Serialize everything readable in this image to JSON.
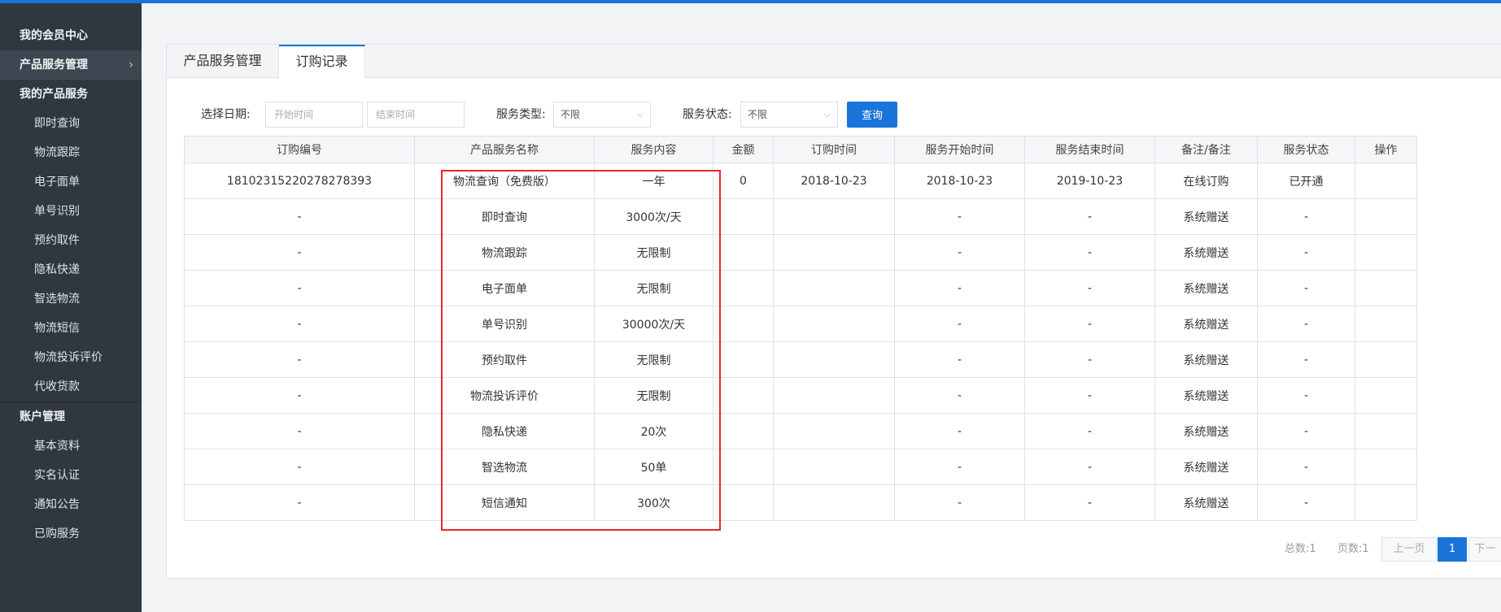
{
  "sidebar": {
    "sections": [
      {
        "label": "我的会员中心",
        "active": false
      },
      {
        "label": "产品服务管理",
        "active": true
      },
      {
        "label": "我的产品服务",
        "active": false
      }
    ],
    "product_items": [
      "即时查询",
      "物流跟踪",
      "电子面单",
      "单号识别",
      "预约取件",
      "隐私快递",
      "智选物流",
      "物流短信",
      "物流投诉评价",
      "代收货款"
    ],
    "account_section": "账户管理",
    "account_items": [
      "基本资料",
      "实名认证",
      "通知公告",
      "已购服务"
    ],
    "active_chevron": "›"
  },
  "tabs": [
    "产品服务管理",
    "订购记录"
  ],
  "filter": {
    "date_label": "选择日期:",
    "start_placeholder": "开始时间",
    "end_placeholder": "结束时间",
    "type_label": "服务类型:",
    "type_value": "不限",
    "status_label": "服务状态:",
    "status_value": "不限",
    "query_button": "查询"
  },
  "table": {
    "headers": [
      "订购编号",
      "产品服务名称",
      "服务内容",
      "金额",
      "订购时间",
      "服务开始时间",
      "服务结束时间",
      "备注/备注",
      "服务状态",
      "操作"
    ],
    "rows": [
      [
        "18102315220278278393",
        "物流查询（免费版）",
        "一年",
        "0",
        "2018-10-23",
        "2018-10-23",
        "2019-10-23",
        "在线订购",
        "已开通",
        ""
      ],
      [
        "-",
        "即时查询",
        "3000次/天",
        "",
        "",
        "-",
        "-",
        "系统赠送",
        "-",
        ""
      ],
      [
        "-",
        "物流跟踪",
        "无限制",
        "",
        "",
        "-",
        "-",
        "系统赠送",
        "-",
        ""
      ],
      [
        "-",
        "电子面单",
        "无限制",
        "",
        "",
        "-",
        "-",
        "系统赠送",
        "-",
        ""
      ],
      [
        "-",
        "单号识别",
        "30000次/天",
        "",
        "",
        "-",
        "-",
        "系统赠送",
        "-",
        ""
      ],
      [
        "-",
        "预约取件",
        "无限制",
        "",
        "",
        "-",
        "-",
        "系统赠送",
        "-",
        ""
      ],
      [
        "-",
        "物流投诉评价",
        "无限制",
        "",
        "",
        "-",
        "-",
        "系统赠送",
        "-",
        ""
      ],
      [
        "-",
        "隐私快递",
        "20次",
        "",
        "",
        "-",
        "-",
        "系统赠送",
        "-",
        ""
      ],
      [
        "-",
        "智选物流",
        "50单",
        "",
        "",
        "-",
        "-",
        "系统赠送",
        "-",
        ""
      ],
      [
        "-",
        "短信通知",
        "300次",
        "",
        "",
        "-",
        "-",
        "系统赠送",
        "-",
        ""
      ]
    ]
  },
  "pager": {
    "total": "总数:1",
    "pages": "页数:1",
    "prev": "上一页",
    "current": "1",
    "next": "下一"
  },
  "colors": {
    "accent": "#1a73d9",
    "sidebar_bg": "#2f3740",
    "highlight": "#e8282c"
  }
}
